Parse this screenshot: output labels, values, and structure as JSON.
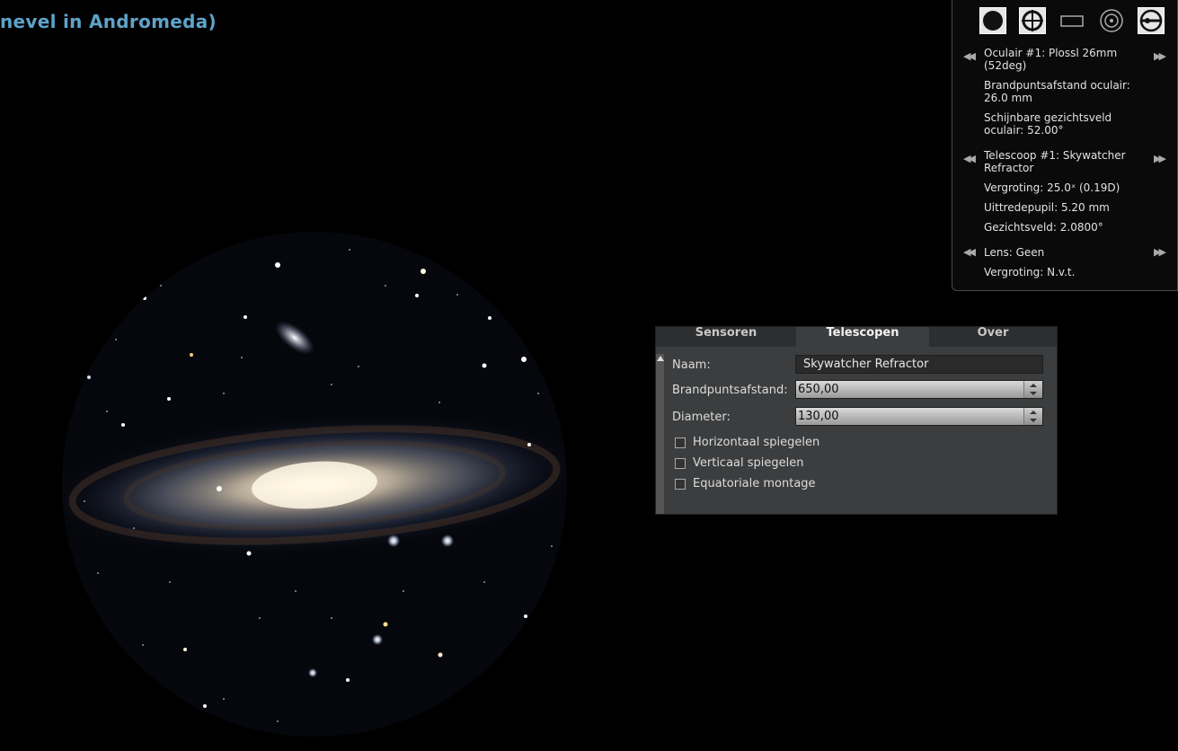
{
  "object_title": "nevel in Andromeda)",
  "ocular_panel": {
    "tools": [
      "ocular-view-icon",
      "crosshair-icon",
      "sensor-frame-icon",
      "telrad-icon",
      "settings-icon"
    ],
    "ocular_name": "Oculair #1: Plossl 26mm (52deg)",
    "ocular_focal": "Brandpuntsafstand oculair: 26.0 mm",
    "ocular_fov": "Schijnbare gezichtsveld oculair: 52.00°",
    "telescope_name": "Telescoop #1: Skywatcher Refractor",
    "magnification": "Vergroting: 25.0ˣ (0.19D)",
    "exit_pupil": "Uittredepupil: 5.20 mm",
    "field_of_view": "Gezichtsveld: 2.0800°",
    "lens": "Lens: Geen",
    "lens_magnification": "Vergroting: N.v.t."
  },
  "dialog": {
    "tabs": [
      "Sensoren",
      "Telescopen",
      "Over"
    ],
    "active_tab": "Telescopen",
    "name_label": "Naam:",
    "name_value": "Skywatcher Refractor",
    "focal_label": "Brandpuntsafstand:",
    "focal_value": "650,00",
    "diameter_label": "Diameter:",
    "diameter_value": "130,00",
    "checkboxes": [
      {
        "label": "Horizontaal spiegelen",
        "checked": false
      },
      {
        "label": "Verticaal spiegelen",
        "checked": false
      },
      {
        "label": "Equatoriale montage",
        "checked": false
      }
    ]
  },
  "colors": {
    "title": "#5fa3c9",
    "background": "#000000",
    "panel": "#3c3d3e"
  }
}
